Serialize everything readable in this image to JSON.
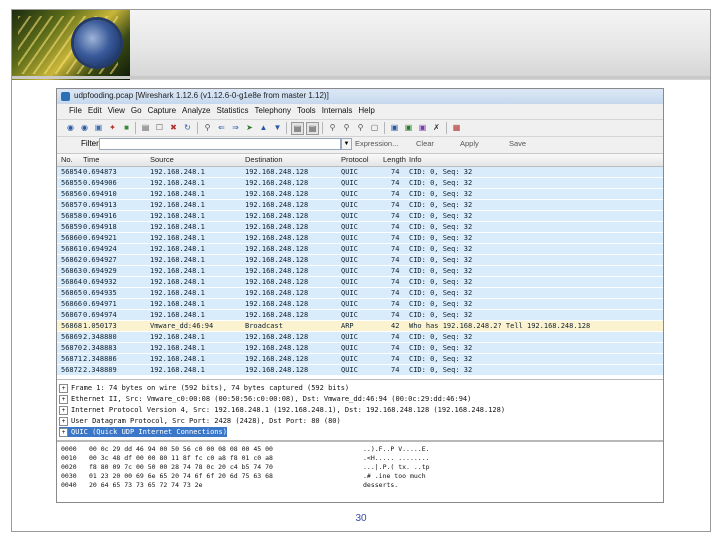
{
  "slide": {
    "page_number": "30"
  },
  "window": {
    "title": "udpfooding.pcap [Wireshark 1.12.6 (v1.12.6-0-g1e8e from master 1.12)]"
  },
  "menu": [
    "File",
    "Edit",
    "View",
    "Go",
    "Capture",
    "Analyze",
    "Statistics",
    "Telephony",
    "Tools",
    "Internals",
    "Help"
  ],
  "toolbar_icons": [
    "open-icon",
    "close-file-icon",
    "save-icon",
    "reload-icon",
    "capture-options-icon",
    "print-icon",
    "find-icon",
    "back-icon",
    "forward-icon",
    "go-to-icon",
    "first-icon",
    "last-icon",
    "colorize-icon",
    "auto-scroll-icon",
    "zoom-in-icon",
    "zoom-out-icon",
    "normal-size-icon",
    "resize-columns-icon",
    "capture-filters-icon",
    "display-filters-icon",
    "coloring-rules-icon",
    "preferences-icon",
    "help-icon"
  ],
  "filter": {
    "label": "Filter:",
    "value": "",
    "buttons": [
      "Expression...",
      "Clear",
      "Apply",
      "Save"
    ]
  },
  "columns": [
    "No.",
    "Time",
    "Source",
    "Destination",
    "Protocol",
    "Length",
    "Info"
  ],
  "packets": [
    {
      "no": "56854",
      "time": "0.694873",
      "src": "192.168.248.1",
      "dst": "192.168.248.128",
      "proto": "QUIC",
      "len": "74",
      "info": "CID: 0, Seq: 32",
      "type": "quic"
    },
    {
      "no": "56855",
      "time": "0.694906",
      "src": "192.168.248.1",
      "dst": "192.168.248.128",
      "proto": "QUIC",
      "len": "74",
      "info": "CID: 0, Seq: 32",
      "type": "quic"
    },
    {
      "no": "56856",
      "time": "0.694910",
      "src": "192.168.248.1",
      "dst": "192.168.248.128",
      "proto": "QUIC",
      "len": "74",
      "info": "CID: 0, Seq: 32",
      "type": "quic"
    },
    {
      "no": "56857",
      "time": "0.694913",
      "src": "192.168.248.1",
      "dst": "192.168.248.128",
      "proto": "QUIC",
      "len": "74",
      "info": "CID: 0, Seq: 32",
      "type": "quic"
    },
    {
      "no": "56858",
      "time": "0.694916",
      "src": "192.168.248.1",
      "dst": "192.168.248.128",
      "proto": "QUIC",
      "len": "74",
      "info": "CID: 0, Seq: 32",
      "type": "quic"
    },
    {
      "no": "56859",
      "time": "0.694918",
      "src": "192.168.248.1",
      "dst": "192.168.248.128",
      "proto": "QUIC",
      "len": "74",
      "info": "CID: 0, Seq: 32",
      "type": "quic"
    },
    {
      "no": "56860",
      "time": "0.694921",
      "src": "192.168.248.1",
      "dst": "192.168.248.128",
      "proto": "QUIC",
      "len": "74",
      "info": "CID: 0, Seq: 32",
      "type": "quic"
    },
    {
      "no": "56861",
      "time": "0.694924",
      "src": "192.168.248.1",
      "dst": "192.168.248.128",
      "proto": "QUIC",
      "len": "74",
      "info": "CID: 0, Seq: 32",
      "type": "quic"
    },
    {
      "no": "56862",
      "time": "0.694927",
      "src": "192.168.248.1",
      "dst": "192.168.248.128",
      "proto": "QUIC",
      "len": "74",
      "info": "CID: 0, Seq: 32",
      "type": "quic"
    },
    {
      "no": "56863",
      "time": "0.694929",
      "src": "192.168.248.1",
      "dst": "192.168.248.128",
      "proto": "QUIC",
      "len": "74",
      "info": "CID: 0, Seq: 32",
      "type": "quic"
    },
    {
      "no": "56864",
      "time": "0.694932",
      "src": "192.168.248.1",
      "dst": "192.168.248.128",
      "proto": "QUIC",
      "len": "74",
      "info": "CID: 0, Seq: 32",
      "type": "quic"
    },
    {
      "no": "56865",
      "time": "0.694935",
      "src": "192.168.248.1",
      "dst": "192.168.248.128",
      "proto": "QUIC",
      "len": "74",
      "info": "CID: 0, Seq: 32",
      "type": "quic"
    },
    {
      "no": "56866",
      "time": "0.694971",
      "src": "192.168.248.1",
      "dst": "192.168.248.128",
      "proto": "QUIC",
      "len": "74",
      "info": "CID: 0, Seq: 32",
      "type": "quic"
    },
    {
      "no": "56867",
      "time": "0.694974",
      "src": "192.168.248.1",
      "dst": "192.168.248.128",
      "proto": "QUIC",
      "len": "74",
      "info": "CID: 0, Seq: 32",
      "type": "quic"
    },
    {
      "no": "56868",
      "time": "1.050173",
      "src": "Vmware_dd:46:94",
      "dst": "Broadcast",
      "proto": "ARP",
      "len": "42",
      "info": "Who has 192.168.248.2?  Tell 192.168.248.128",
      "type": "arp"
    },
    {
      "no": "56869",
      "time": "2.348880",
      "src": "192.168.248.1",
      "dst": "192.168.248.128",
      "proto": "QUIC",
      "len": "74",
      "info": "CID: 0, Seq: 32",
      "type": "quic"
    },
    {
      "no": "56870",
      "time": "2.348883",
      "src": "192.168.248.1",
      "dst": "192.168.248.128",
      "proto": "QUIC",
      "len": "74",
      "info": "CID: 0, Seq: 32",
      "type": "quic"
    },
    {
      "no": "56871",
      "time": "2.348886",
      "src": "192.168.248.1",
      "dst": "192.168.248.128",
      "proto": "QUIC",
      "len": "74",
      "info": "CID: 0, Seq: 32",
      "type": "quic"
    },
    {
      "no": "56872",
      "time": "2.348889",
      "src": "192.168.248.1",
      "dst": "192.168.248.128",
      "proto": "QUIC",
      "len": "74",
      "info": "CID: 0, Seq: 32",
      "type": "quic"
    }
  ],
  "details": [
    {
      "text": "Frame 1: 74 bytes on wire (592 bits), 74 bytes captured (592 bits)",
      "selected": false
    },
    {
      "text": "Ethernet II, Src: Vmware_c0:00:08 (00:50:56:c0:00:08), Dst: Vmware_dd:46:94 (00:0c:29:dd:46:94)",
      "selected": false
    },
    {
      "text": "Internet Protocol Version 4, Src: 192.168.248.1 (192.168.248.1), Dst: 192.168.248.128 (192.168.248.128)",
      "selected": false
    },
    {
      "text": "User Datagram Protocol, Src Port: 2428 (2428), Dst Port: 80 (80)",
      "selected": false
    },
    {
      "text": "QUIC (Quick UDP Internet Connections)",
      "selected": true
    }
  ],
  "bytes": [
    {
      "off": "0000",
      "hex": "00 0c 29 dd 46 94 00 50  56 c0 00 08 08 00 45 00",
      "ascii": "..).F..P V.....E."
    },
    {
      "off": "0010",
      "hex": "00 3c 48 df 00 00 80 11  8f fc c0 a8 f8 01 c0 a8",
      "ascii": ".<H..... ........"
    },
    {
      "off": "0020",
      "hex": "f8 80 09 7c 00 50 00 28  74 78 0c 20 c4 b5 74 70",
      "ascii": "...|.P.( tx. ..tp"
    },
    {
      "off": "0030",
      "hex": "01 23 20 00 69 6e 65 20  74 6f 6f 20 6d 75 63 68",
      "ascii": ".# .ine  too much"
    },
    {
      "off": "0040",
      "hex": "20 64 65 73 73 65 72 74  73 2e",
      "ascii": " desserts."
    }
  ]
}
